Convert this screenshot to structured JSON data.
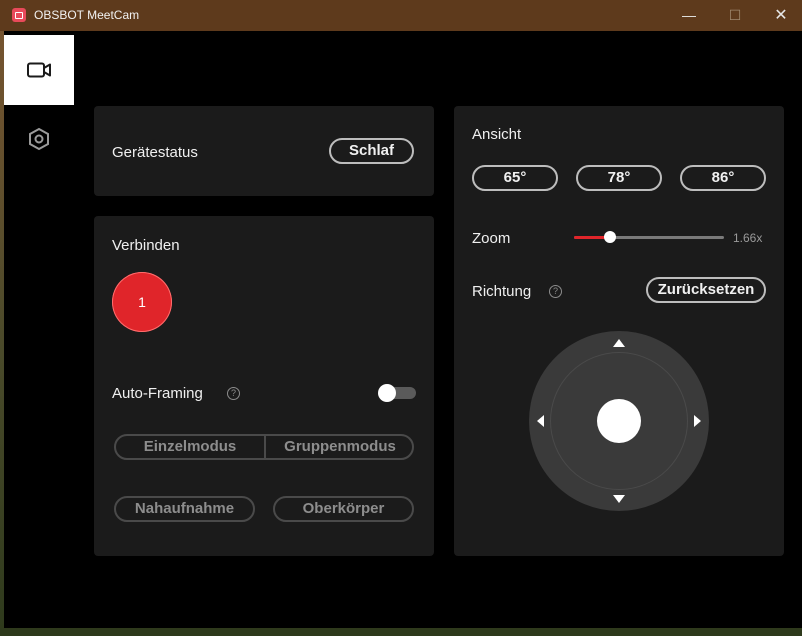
{
  "window": {
    "title": "OBSBOT MeetCam",
    "minimize": "—",
    "maximize": "☐",
    "close": "✕"
  },
  "nav": {
    "items": [
      {
        "icon": "video-camera-icon",
        "active": true
      },
      {
        "icon": "gear-icon",
        "active": false
      }
    ]
  },
  "status": {
    "label": "Gerätestatus",
    "button": "Schlaf"
  },
  "connect": {
    "label": "Verbinden",
    "device_number": "1"
  },
  "autoframing": {
    "label": "Auto-Framing",
    "help": "?",
    "enabled": false,
    "modes": [
      "Einzelmodus",
      "Gruppenmodus"
    ],
    "framing": [
      "Nahaufnahme",
      "Oberkörper"
    ]
  },
  "view": {
    "label": "Ansicht",
    "options": [
      "65°",
      "78°",
      "86°"
    ]
  },
  "zoom": {
    "label": "Zoom",
    "value": "1.66x",
    "fraction": 0.24
  },
  "direction": {
    "label": "Richtung",
    "help": "?",
    "reset": "Zurücksetzen"
  },
  "colors": {
    "accent": "#e0252a",
    "panel": "#1b1b1b",
    "titlebar": "#5e3a1c"
  }
}
